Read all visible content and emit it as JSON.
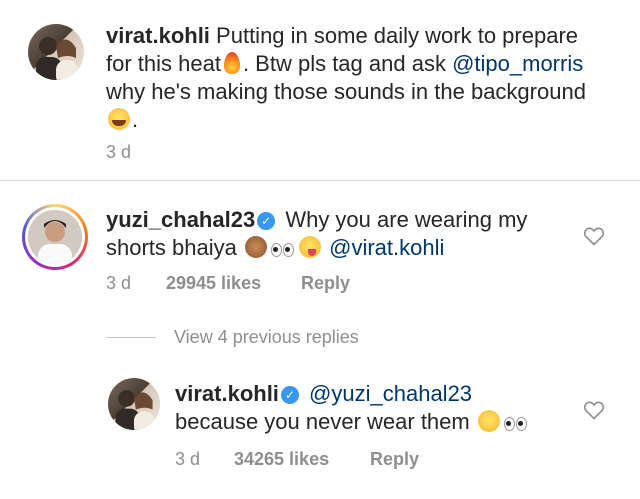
{
  "post": {
    "username": "virat.kohli",
    "caption_part1": "Putting in some daily work to prepare for this heat",
    "caption_part2": ". Btw pls tag and ask",
    "mention": "@tipo_morris",
    "caption_part3": "why he's making those sounds in the background",
    "caption_end": ".",
    "time": "3 d"
  },
  "comment": {
    "username": "yuzi_chahal23",
    "text": "Why you are wearing my shorts bhaiya",
    "mention": "@virat.kohli",
    "time": "3 d",
    "likes": "29945 likes",
    "reply_label": "Reply",
    "view_replies": "View 4 previous replies"
  },
  "reply": {
    "username": "virat.kohli",
    "mention": "@yuzi_chahal23",
    "text": "because you never wear them",
    "time": "3 d",
    "likes": "34265 likes",
    "reply_label": "Reply"
  },
  "icons": {
    "verified": "verified-badge-icon",
    "heart": "heart-outline-icon"
  },
  "colors": {
    "text": "#262626",
    "muted": "#8e8e8e",
    "mention": "#00376b",
    "verified": "#3897f0"
  }
}
